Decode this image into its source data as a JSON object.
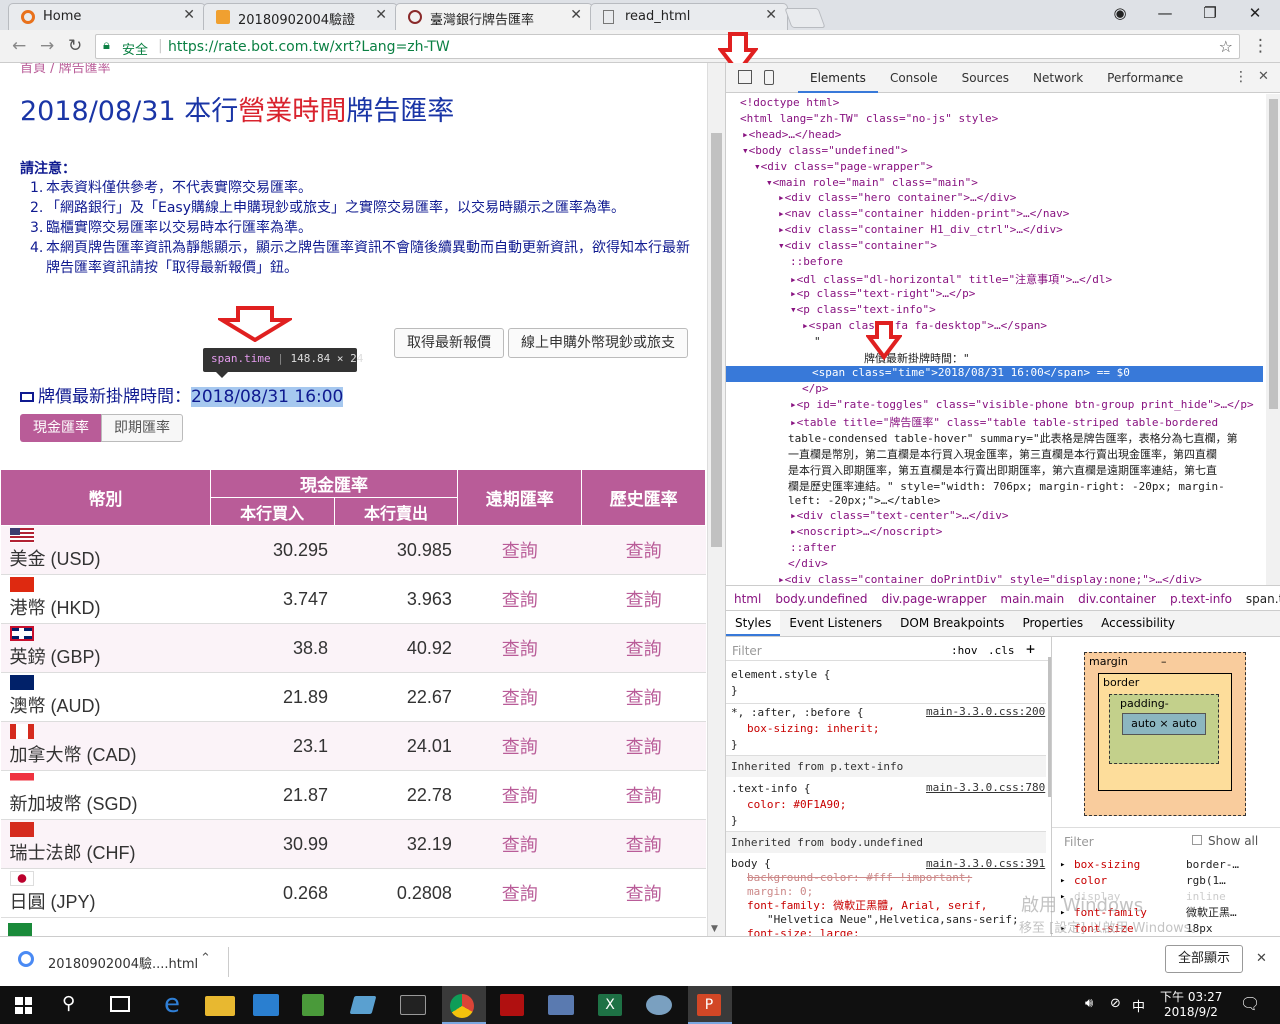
{
  "tabs": [
    {
      "title": "Home",
      "icon": "chrome-icon"
    },
    {
      "title": "20180902004驗證",
      "icon": "document-icon"
    },
    {
      "title": "臺灣銀行牌告匯率",
      "icon": "bank-logo-icon"
    },
    {
      "title": "read_html",
      "icon": "page-icon"
    }
  ],
  "omnibox": {
    "secure_label": "安全",
    "url": "https://rate.bot.com.tw/xrt?Lang=zh-TW"
  },
  "page": {
    "breadcrumb": "首頁 / 牌告匯率",
    "title_part1": "2018/08/31 本行",
    "title_part2": "營業時間",
    "title_part3": "牌告匯率",
    "notice_title": "請注意：",
    "notices": [
      "本表資料僅供參考，不代表實際交易匯率。",
      "「網路銀行」及「Easy購線上申購現鈔或旅支」之實際交易匯率，以交易時顯示之匯率為準。",
      "臨櫃實際交易匯率以交易時本行匯率為準。",
      "本網頁牌告匯率資訊為靜態顯示，顯示之牌告匯率資訊不會隨後續異動而自動更新資訊，欲得知本行最新牌告匯率資訊請按「取得最新報價」鈕。"
    ],
    "btn_refresh": "取得最新報價",
    "btn_online": "線上申購外幣現鈔或旅支",
    "tooltip_tag": "span.time",
    "tooltip_size": "148.84 × 24",
    "time_label": "牌價最新掛牌時間：",
    "time_value": "2018/08/31 16:00",
    "toggle_cash": "現金匯率",
    "toggle_spot": "即期匯率",
    "table": {
      "h_currency": "幣別",
      "h_cash": "現金匯率",
      "h_forward": "遠期匯率",
      "h_history": "歷史匯率",
      "h_buy": "本行買入",
      "h_sell": "本行賣出",
      "query": "查詢",
      "rows": [
        {
          "name": "美金 (USD)",
          "buy": "30.295",
          "sell": "30.985",
          "flag": "us-flag-icon"
        },
        {
          "name": "港幣 (HKD)",
          "buy": "3.747",
          "sell": "3.963",
          "flag": "hk-flag-icon"
        },
        {
          "name": "英鎊 (GBP)",
          "buy": "38.8",
          "sell": "40.92",
          "flag": "uk-flag-icon"
        },
        {
          "name": "澳幣 (AUD)",
          "buy": "21.89",
          "sell": "22.67",
          "flag": "au-flag-icon"
        },
        {
          "name": "加拿大幣 (CAD)",
          "buy": "23.1",
          "sell": "24.01",
          "flag": "ca-flag-icon"
        },
        {
          "name": "新加坡幣 (SGD)",
          "buy": "21.87",
          "sell": "22.78",
          "flag": "sg-flag-icon"
        },
        {
          "name": "瑞士法郎 (CHF)",
          "buy": "30.99",
          "sell": "32.19",
          "flag": "ch-flag-icon"
        },
        {
          "name": "日圓 (JPY)",
          "buy": "0.268",
          "sell": "0.2808",
          "flag": "jp-flag-icon"
        }
      ]
    }
  },
  "devtools": {
    "tabs": [
      "Elements",
      "Console",
      "Sources",
      "Network",
      "Performance"
    ],
    "dom_lines": [
      "<!doctype html>",
      "<html lang=\"zh-TW\" class=\"no-js\" style>",
      "▸<head>…</head>",
      "▾<body class=\"undefined\">",
      "▾<div class=\"page-wrapper\">",
      "▾<main role=\"main\" class=\"main\">",
      "▸<div class=\"hero container\">…</div>",
      "▸<nav class=\"container hidden-print\">…</nav>",
      "▸<div class=\"container H1_div_ctrl\">…</div>",
      "▾<div class=\"container\">",
      "::before",
      "▸<dl class=\"dl-horizontal\" title=\"注意事項\">…</dl>",
      "▸<p class=\"text-right\">…</p>",
      "▾<p class=\"text-info\">",
      "▸<span class=\"fa fa-desktop\">…</span>",
      "\"",
      "牌價最新掛牌時間：\"",
      "<span class=\"time\">2018/08/31 16:00</span> == $0",
      "</p>",
      "▸<p id=\"rate-toggles\" class=\"visible-phone btn-group print_hide\">…</p>",
      "▸<table title=\"牌告匯率\" class=\"table table-striped table-bordered",
      "table-condensed table-hover\" summary=\"此表格是牌告匯率，表格分為七直欄，第",
      "一直欄是幣別，第二直欄是本行買入現金匯率，第三直欄是本行賣出現金匯率，第四直欄",
      "是本行買入即期匯率，第五直欄是本行賣出即期匯率，第六直欄是遠期匯率連結，第七直",
      "欄是歷史匯率連結。\" style=\"width: 706px; margin-right: -20px; margin-",
      "left: -20px;\">…</table>",
      "▸<div class=\"text-center\">…</div>",
      "▸<noscript>…</noscript>",
      "::after",
      "</div>",
      "▸<div class=\"container doPrintDiv\" style=\"display:none;\">…</div>"
    ],
    "breadcrumbs": [
      "html",
      "body.undefined",
      "div.page-wrapper",
      "main.main",
      "div.container",
      "p.text-info",
      "span.time"
    ],
    "lower_tabs": [
      "Styles",
      "Event Listeners",
      "DOM Breakpoints",
      "Properties",
      "Accessibility"
    ],
    "filter_placeholder": "Filter",
    "hov": ":hov",
    "cls": ".cls",
    "styles": [
      "element.style {",
      "}",
      "*, :after, :before {",
      "box-sizing: inherit;",
      "}",
      "Inherited from p.text-info",
      ".text-info {",
      "color: #0F1A90;",
      "}",
      "Inherited from body.undefined",
      "body {",
      "background-color: #fff !important;",
      "margin: 0;",
      "font-family: 微軟正黑體, Arial, serif,",
      "\"Helvetica Neue\",Helvetica,sans-serif;",
      "font-size: large;"
    ],
    "css_link1": "main-3.3.0.css:200",
    "css_link2": "main-3.3.0.css:780",
    "css_link3": "main-3.3.0.css:391",
    "box_margin": "margin",
    "box_border": "border",
    "box_padding": "padding-",
    "box_content": "auto × auto",
    "dash": "–",
    "computed_filter": "Filter",
    "show_all": "Show all",
    "computed": [
      {
        "prop": "box-sizing",
        "val": "border-…"
      },
      {
        "prop": "color",
        "val": "rgb(1…"
      },
      {
        "prop": "display",
        "val": "inline"
      },
      {
        "prop": "font-family",
        "val": "微軟正黑…"
      },
      {
        "prop": "font-size",
        "val": "18px"
      }
    ],
    "watermark1": "啟用 Windows",
    "watermark2": "移至 [設定] 以啟用 Windows。"
  },
  "download": {
    "file": "20180902004驗....html",
    "show_all": "全部顯示"
  },
  "taskbar": {
    "time": "下午 03:27",
    "date": "2018/9/2"
  },
  "colors": {
    "accent_pink": "#b95c98",
    "title_blue": "#1a35a6",
    "red": "#d9232e",
    "devtools_select": "#3879d9"
  }
}
